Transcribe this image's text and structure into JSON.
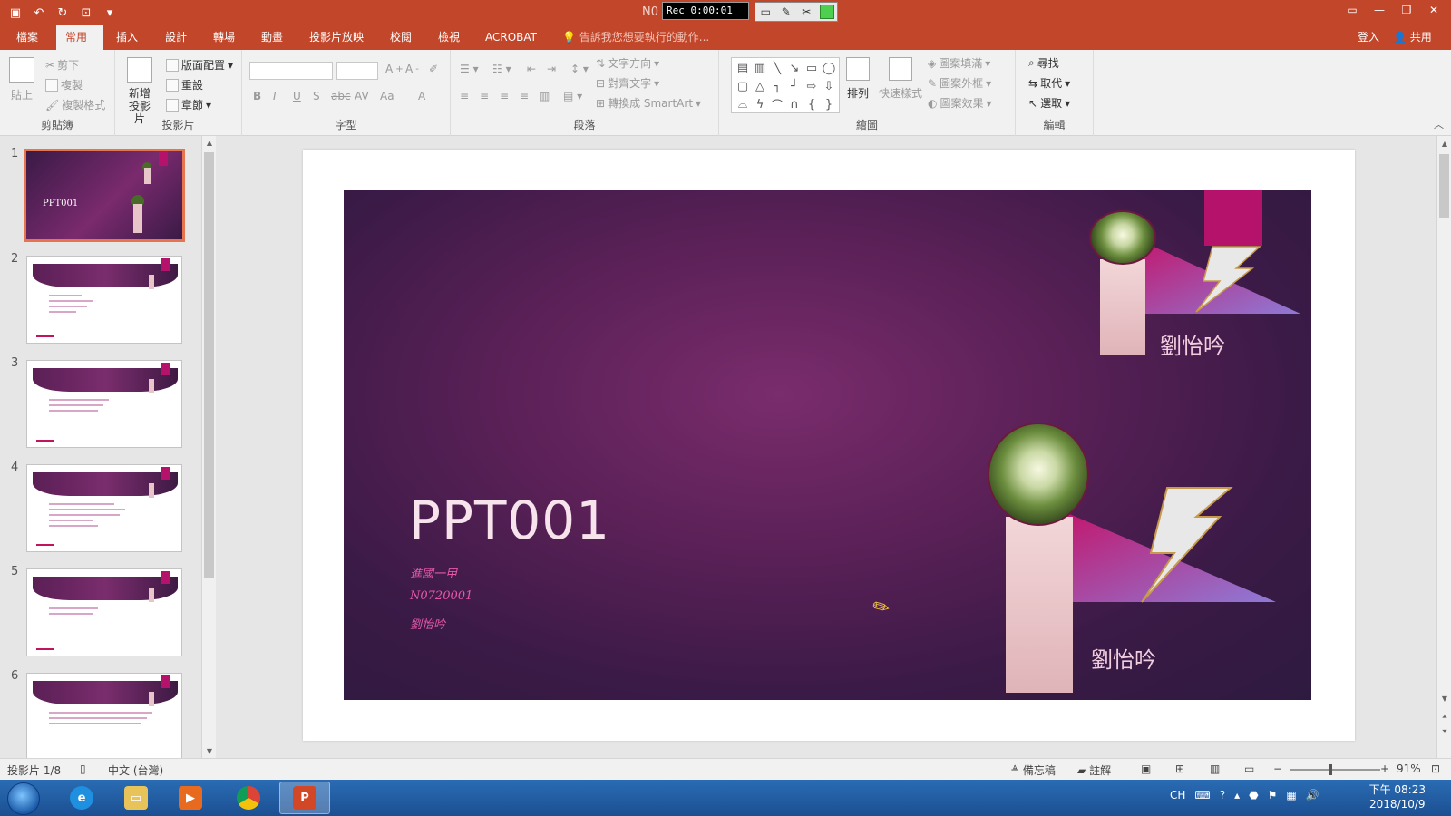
{
  "titlebar": {
    "doc_title": "N0",
    "rec_text": "Rec 0:00:01"
  },
  "tabs": [
    {
      "label": "檔案"
    },
    {
      "label": "常用"
    },
    {
      "label": "插入"
    },
    {
      "label": "設計"
    },
    {
      "label": "轉場"
    },
    {
      "label": "動畫"
    },
    {
      "label": "投影片放映"
    },
    {
      "label": "校閱"
    },
    {
      "label": "檢視"
    },
    {
      "label": "ACROBAT"
    }
  ],
  "tell_me": "告訴我您想要執行的動作...",
  "signin": "登入",
  "share": "共用",
  "ribbon": {
    "clipboard": {
      "paste": "貼上",
      "cut": "剪下",
      "copy": "複製",
      "format_painter": "複製格式",
      "name": "剪貼簿"
    },
    "slides": {
      "new_slide": "新增投影片",
      "layout": "版面配置",
      "reset": "重設",
      "section": "章節",
      "name": "投影片"
    },
    "font": {
      "name": "字型",
      "b": "B",
      "i": "I",
      "u": "U",
      "s": "S",
      "abc": "abc",
      "av": "AV",
      "aa": "Aa",
      "a": "A"
    },
    "paragraph": {
      "text_direction": "文字方向",
      "align_text": "對齊文字",
      "smartart": "轉換成 SmartArt",
      "name": "段落"
    },
    "drawing": {
      "arrange": "排列",
      "quick_styles": "快速樣式",
      "shape_fill": "圖案填滿",
      "shape_outline": "圖案外框",
      "shape_effects": "圖案效果",
      "name": "繪圖"
    },
    "editing": {
      "find": "尋找",
      "replace": "取代",
      "select": "選取",
      "name": "編輯"
    }
  },
  "thumbnails": [
    {
      "num": "1",
      "title": "PPT001"
    },
    {
      "num": "2"
    },
    {
      "num": "3"
    },
    {
      "num": "4"
    },
    {
      "num": "5"
    },
    {
      "num": "6"
    }
  ],
  "slide": {
    "title": "PPT001",
    "sub1": "進國一甲",
    "sub2": "N0720001",
    "sub3": "劉怡吟",
    "name_top": "劉怡吟",
    "name_bottom": "劉怡吟"
  },
  "status": {
    "slide_count": "投影片 1/8",
    "language": "中文 (台灣)",
    "notes": "備忘稿",
    "comments": "註解",
    "zoom": "91%",
    "zoom_level_percent": 91
  },
  "taskbar": {
    "ime": "CH",
    "time": "下午 08:23",
    "date": "2018/10/9"
  }
}
